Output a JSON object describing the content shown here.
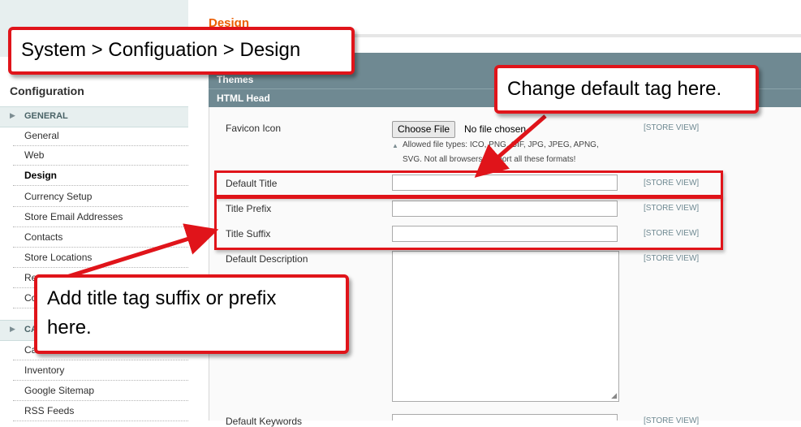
{
  "sidebar": {
    "heading": "Configuration",
    "sections": [
      {
        "label": "GENERAL",
        "arrow": "▶"
      },
      {
        "label": "CA",
        "arrow": "▶"
      }
    ],
    "items": [
      "General",
      "Web",
      "Design",
      "Currency Setup",
      "Store Email Addresses",
      "Contacts",
      "Store Locations",
      "Re",
      "Co",
      "Ca",
      "Inventory",
      "Google Sitemap",
      "RSS Feeds"
    ],
    "active_item": "Design"
  },
  "main": {
    "title": "Design",
    "fieldsets": [
      "Themes",
      "HTML Head"
    ],
    "fields": {
      "favicon": {
        "label": "Favicon Icon",
        "button": "Choose File",
        "file_status": "No file chosen",
        "hint_line1": "Allowed file types: ICO, PNG, GIF, JPG, JPEG, APNG,",
        "hint_line2": "SVG. Not all browsers support all these formats!",
        "scope": "[STORE VIEW]"
      },
      "default_title": {
        "label": "Default Title",
        "value": "",
        "scope": "[STORE VIEW]"
      },
      "title_prefix": {
        "label": "Title Prefix",
        "value": "",
        "scope": "[STORE VIEW]"
      },
      "title_suffix": {
        "label": "Title Suffix",
        "value": "",
        "scope": "[STORE VIEW]"
      },
      "default_description": {
        "label": "Default Description",
        "value": "",
        "scope": "[STORE VIEW]"
      },
      "default_keywords": {
        "label": "Default Keywords",
        "scope": "[STORE VIEW]"
      }
    }
  },
  "annotations": {
    "breadcrumb": "System > Configuation > Design",
    "default_tag": "Change default tag here.",
    "suffix_line1": "Add title tag suffix or prefix",
    "suffix_line2": "here."
  },
  "colors": {
    "accent_red": "#e0141a",
    "header_bg": "#6f8992",
    "title_orange": "#eb5e00",
    "sidebar_bg": "#e7efef"
  }
}
